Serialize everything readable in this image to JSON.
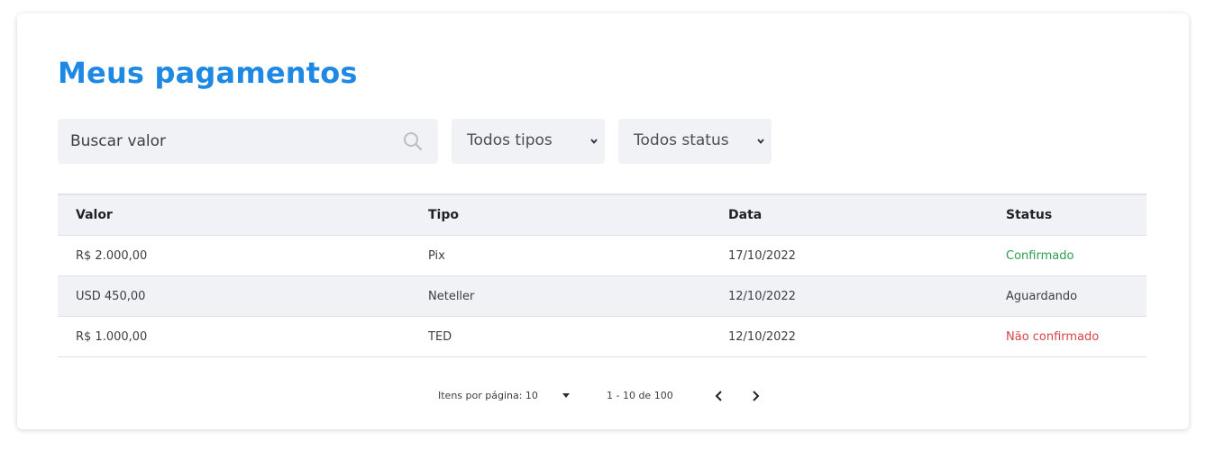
{
  "page": {
    "title": "Meus pagamentos"
  },
  "filters": {
    "search_placeholder": "Buscar valor",
    "tipo_selected": "Todos tipos",
    "status_selected": "Todos status"
  },
  "table": {
    "headers": [
      "Valor",
      "Tipo",
      "Data",
      "Status"
    ],
    "rows": [
      {
        "valor": "R$ 2.000,00",
        "tipo": "Pix",
        "data": "17/10/2022",
        "status": "Confirmado",
        "status_color": "#2e9e4f"
      },
      {
        "valor": "USD 450,00",
        "tipo": "Neteller",
        "data": "12/10/2022",
        "status": "Aguardando",
        "status_color": "#3a3f45"
      },
      {
        "valor": "R$ 1.000,00",
        "tipo": "TED",
        "data": "12/10/2022",
        "status": "Não confirmado",
        "status_color": "#d64545"
      }
    ]
  },
  "pagination": {
    "items_per_page": "Itens por página: 10",
    "range": "1 - 10 de 100"
  },
  "colors": {
    "accent": "#1e88e5",
    "confirmed": "#2e9e4f",
    "not_confirmed": "#d64545"
  }
}
